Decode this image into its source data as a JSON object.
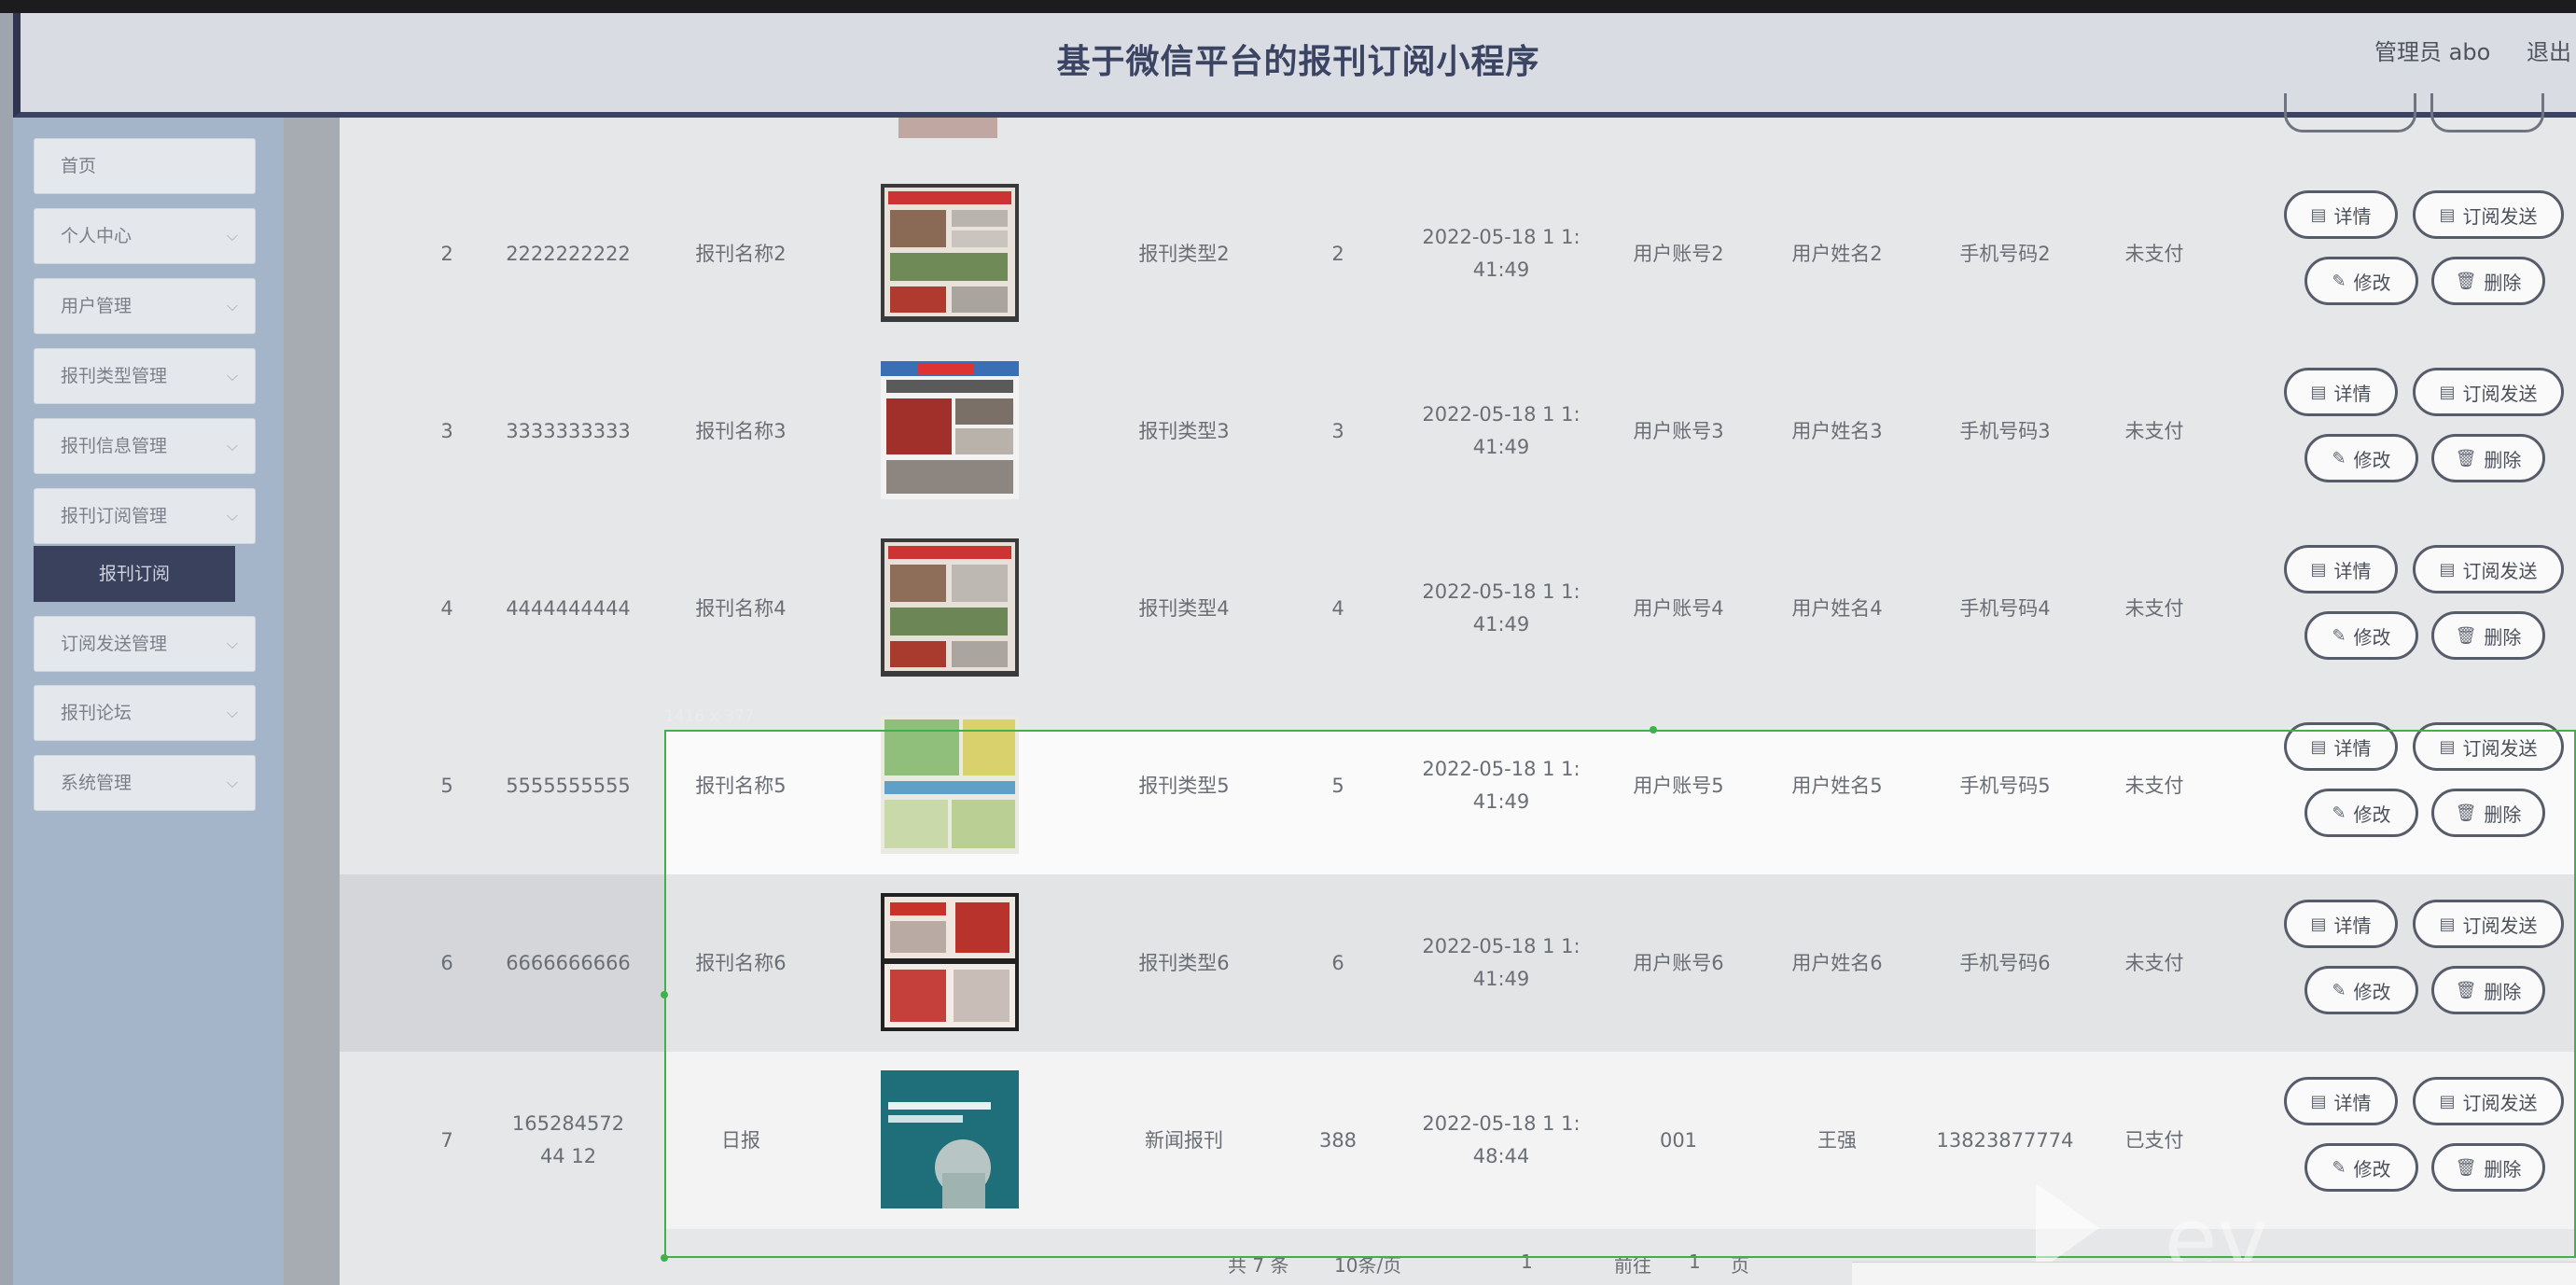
{
  "header": {
    "title": "基于微信平台的报刊订阅小程序",
    "user": "管理员 abo",
    "logout": "退出"
  },
  "sidebar": {
    "items": [
      {
        "label": "首页",
        "chevron": false
      },
      {
        "label": "个人中心",
        "chevron": true
      },
      {
        "label": "用户管理",
        "chevron": true
      },
      {
        "label": "报刊类型管理",
        "chevron": true
      },
      {
        "label": "报刊信息管理",
        "chevron": true
      },
      {
        "label": "报刊订阅管理",
        "chevron": true
      },
      {
        "label": "订阅发送管理",
        "chevron": true
      },
      {
        "label": "报刊论坛",
        "chevron": true
      },
      {
        "label": "系统管理",
        "chevron": true
      }
    ],
    "active_sub": "报刊订阅"
  },
  "selection": {
    "dimensions": "1416 x 377"
  },
  "buttons": {
    "detail": "详情",
    "send": "订阅发送",
    "edit": "修改",
    "delete": "删除"
  },
  "rows": [
    {
      "index": "2",
      "order_no": "2222222222",
      "name": "报刊名称2",
      "type": "报刊类型2",
      "qty": "2",
      "time": "2022-05-18 1 1:41:49",
      "account": "用户账号2",
      "username": "用户姓名2",
      "phone": "手机号码2",
      "status": "未支付"
    },
    {
      "index": "3",
      "order_no": "3333333333",
      "name": "报刊名称3",
      "type": "报刊类型3",
      "qty": "3",
      "time": "2022-05-18 1 1:41:49",
      "account": "用户账号3",
      "username": "用户姓名3",
      "phone": "手机号码3",
      "status": "未支付"
    },
    {
      "index": "4",
      "order_no": "4444444444",
      "name": "报刊名称4",
      "type": "报刊类型4",
      "qty": "4",
      "time": "2022-05-18 1 1:41:49",
      "account": "用户账号4",
      "username": "用户姓名4",
      "phone": "手机号码4",
      "status": "未支付"
    },
    {
      "index": "5",
      "order_no": "5555555555",
      "name": "报刊名称5",
      "type": "报刊类型5",
      "qty": "5",
      "time": "2022-05-18 1 1:41:49",
      "account": "用户账号5",
      "username": "用户姓名5",
      "phone": "手机号码5",
      "status": "未支付"
    },
    {
      "index": "6",
      "order_no": "6666666666",
      "name": "报刊名称6",
      "type": "报刊类型6",
      "qty": "6",
      "time": "2022-05-18 1 1:41:49",
      "account": "用户账号6",
      "username": "用户姓名6",
      "phone": "手机号码6",
      "status": "未支付"
    },
    {
      "index": "7",
      "order_no": "16528457244 12",
      "name": "日报",
      "type": "新闻报刊",
      "qty": "388",
      "time": "2022-05-18 1 1:48:44",
      "account": "001",
      "username": "王强",
      "phone": "13823877774",
      "status": "已支付"
    }
  ],
  "pagination": {
    "total": "共 7 条",
    "per_page": "10条/页",
    "current": "1",
    "goto": "前往",
    "goto_page": "1",
    "page_suffix": "页"
  }
}
